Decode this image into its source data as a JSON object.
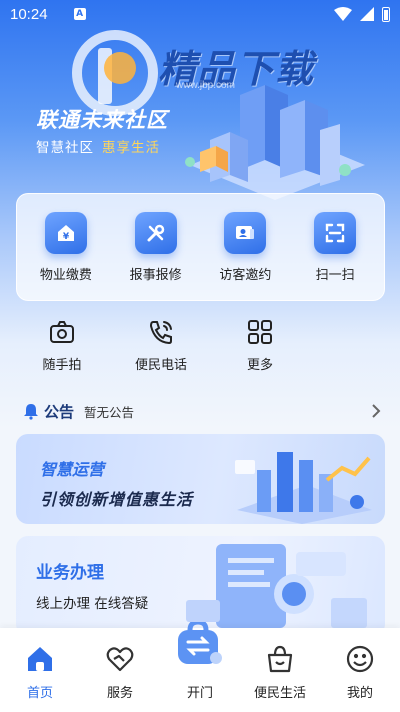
{
  "status_bar": {
    "time": "10:24",
    "notif_badge": "A"
  },
  "watermark": {
    "title": "精品下载",
    "url": "www.jbp.com"
  },
  "hero": {
    "title": "联通未来社区",
    "subtitle": "智慧社区",
    "subtitle_accent": "惠享生活"
  },
  "services": [
    {
      "label": "物业缴费",
      "icon": "yuan-house-icon"
    },
    {
      "label": "报事报修",
      "icon": "tools-icon"
    },
    {
      "label": "访客邀约",
      "icon": "visitor-card-icon"
    },
    {
      "label": "扫一扫",
      "icon": "scan-icon"
    }
  ],
  "shortcuts": [
    {
      "label": "随手拍",
      "icon": "camera-icon"
    },
    {
      "label": "便民电话",
      "icon": "phone-icon"
    },
    {
      "label": "更多",
      "icon": "grid-more-icon"
    }
  ],
  "notice": {
    "title": "公告",
    "text": "暂无公告"
  },
  "banner_ops": {
    "line1": "智慧运营",
    "line2": "引领创新增值惠生活"
  },
  "banner_business": {
    "title": "业务办理",
    "subtitle": "线上办理  在线答疑"
  },
  "bottom_nav": [
    {
      "label": "首页",
      "icon": "home-icon",
      "active": true
    },
    {
      "label": "服务",
      "icon": "heart-hand-icon",
      "active": false
    },
    {
      "label": "开门",
      "icon": "door-open-icon",
      "active": false
    },
    {
      "label": "便民生活",
      "icon": "shopping-bag-icon",
      "active": false
    },
    {
      "label": "我的",
      "icon": "profile-face-icon",
      "active": false
    }
  ],
  "colors": {
    "primary": "#2f6fe8",
    "accent": "#ffd65a",
    "title_dark": "#1d3b7a"
  }
}
